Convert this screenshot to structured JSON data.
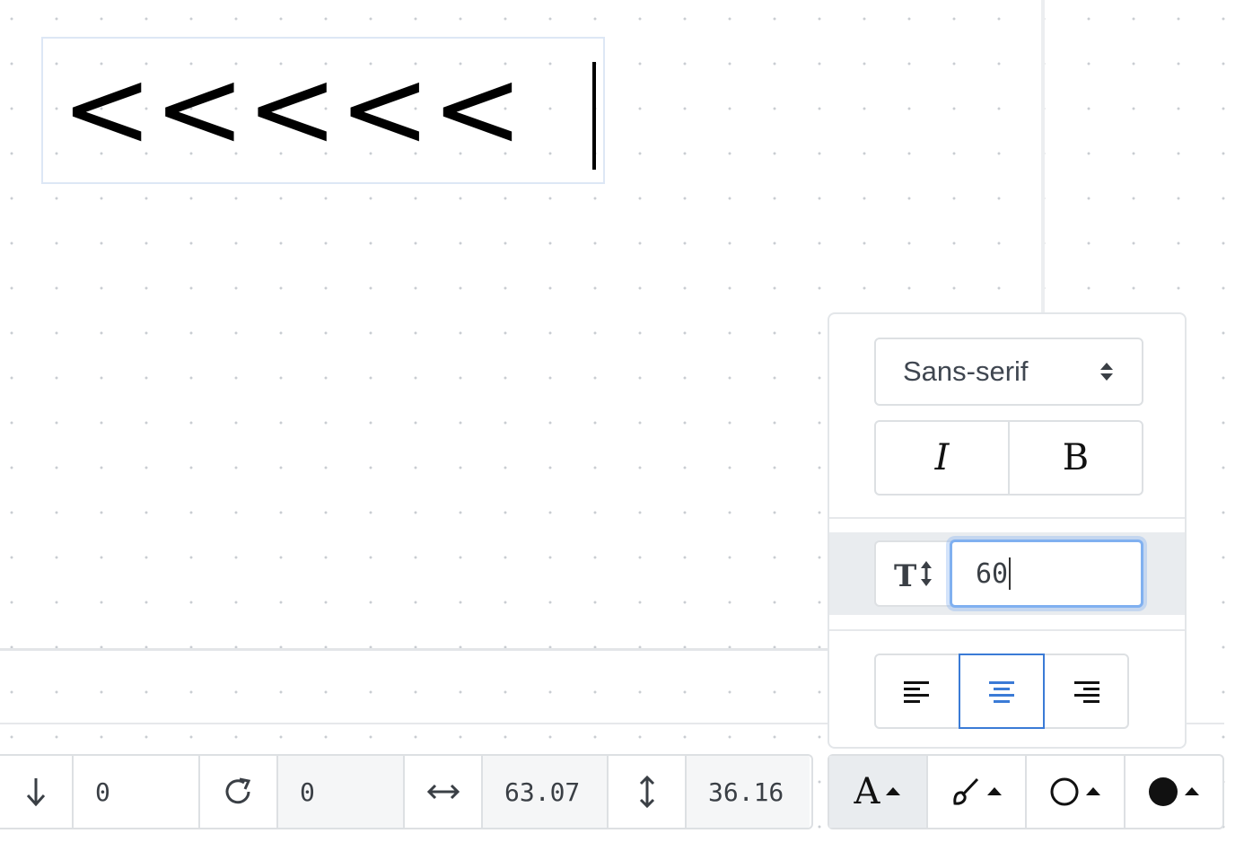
{
  "canvas": {
    "text_content": "<<<<<"
  },
  "text_panel": {
    "font_family": "Sans-serif",
    "italic_label": "I",
    "bold_label": "B",
    "font_size_icon": "text-height-icon",
    "font_size_value": "60",
    "alignment_options": [
      "align-left",
      "align-center",
      "align-right"
    ],
    "selected_alignment": "align-center",
    "accent_color": "#3b7bd6"
  },
  "toolbar": {
    "y_value": "0",
    "rotation_value": "0",
    "width_value": "63.07",
    "height_value": "36.16"
  },
  "style_toolbar": {
    "text_label": "A"
  }
}
